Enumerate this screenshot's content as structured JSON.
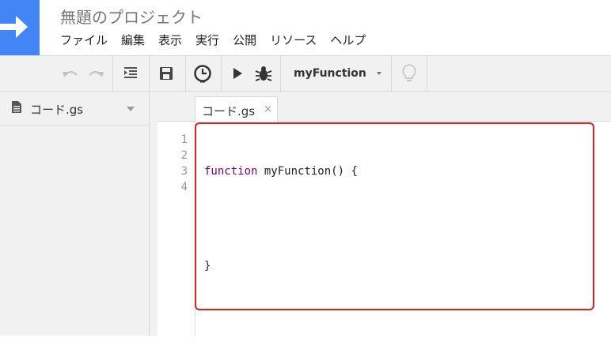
{
  "app": {
    "title": "無題のプロジェクト",
    "brand_color": "#4285f4",
    "logo_icon": "arrow-right-icon"
  },
  "menu": {
    "items": [
      "ファイル",
      "編集",
      "表示",
      "実行",
      "公開",
      "リソース",
      "ヘルプ"
    ]
  },
  "toolbar": {
    "icons": [
      "undo-icon",
      "redo-icon",
      "indent-icon",
      "save-icon",
      "triggers-clock-icon",
      "run-icon",
      "debug-bug-icon",
      "lightbulb-icon"
    ],
    "function_select": "myFunction"
  },
  "sidebar": {
    "files": [
      {
        "name": "コード.gs",
        "icon": "file-icon"
      }
    ]
  },
  "tabs": [
    {
      "label": "コード.gs",
      "close": "×"
    }
  ],
  "editor": {
    "line_numbers": [
      "1",
      "2",
      "3",
      "4"
    ],
    "lines": [
      {
        "keyword": "function",
        "rest": " myFunction() {"
      },
      {
        "keyword": "",
        "rest": ""
      },
      {
        "keyword": "",
        "rest": "}"
      },
      {
        "keyword": "",
        "rest": ""
      }
    ],
    "highlight_color": "#e0201c"
  }
}
